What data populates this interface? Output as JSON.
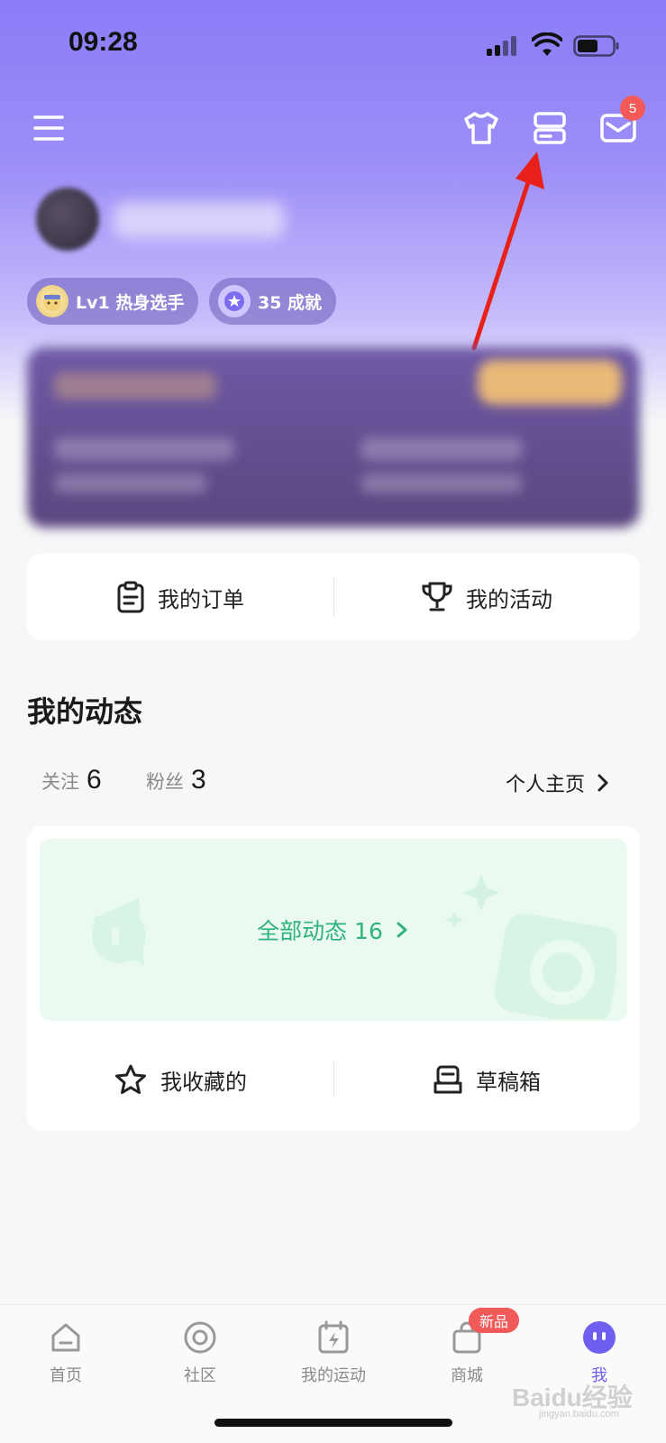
{
  "status_bar": {
    "time": "09:28"
  },
  "topbar": {
    "mail_badge": "5"
  },
  "profile": {
    "level_label": "Lv1 热身选手",
    "achievements_label": "35 成就"
  },
  "quick_actions": {
    "orders_label": "我的订单",
    "activities_label": "我的活动"
  },
  "dynamics": {
    "title": "我的动态",
    "following_label": "关注",
    "following_count": "6",
    "followers_label": "粉丝",
    "followers_count": "3",
    "profile_link": "个人主页",
    "all_feeds": "全部动态 16",
    "favorites_label": "我收藏的",
    "drafts_label": "草稿箱"
  },
  "bottom_nav": {
    "items": [
      {
        "label": "首页",
        "icon": "home-icon"
      },
      {
        "label": "社区",
        "icon": "community-icon"
      },
      {
        "label": "我的运动",
        "icon": "calendar-bolt-icon"
      },
      {
        "label": "商城",
        "icon": "shopping-bag-icon"
      },
      {
        "label": "我",
        "icon": "me-avatar-icon"
      }
    ],
    "new_badge": "新品",
    "active_color": "#6f5ff0"
  },
  "watermark": {
    "brand": "Baidu经验",
    "url": "jingyan.baidu.com"
  },
  "colors": {
    "accent": "#8a7cf6",
    "feed_green": "#2fb37a",
    "badge_red": "#f25a5a",
    "arrow_red": "#e8201a"
  }
}
